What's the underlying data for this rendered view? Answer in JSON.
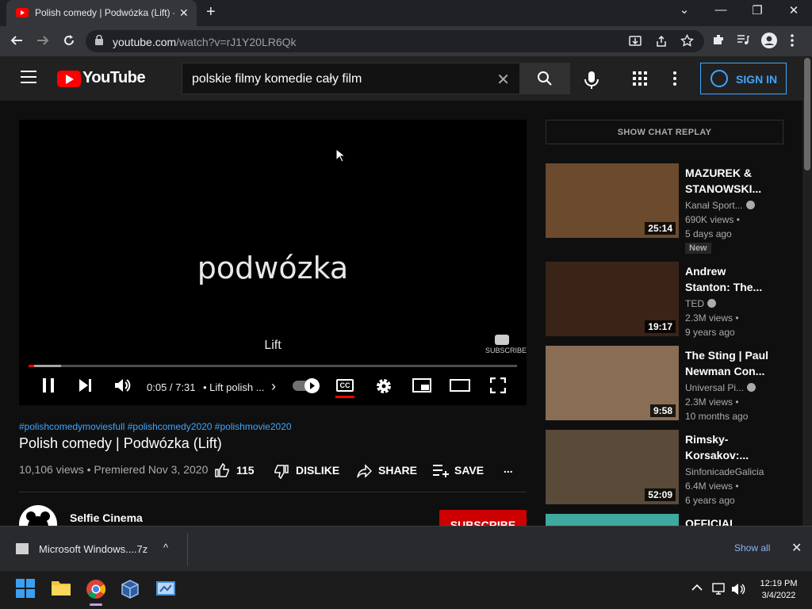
{
  "browser": {
    "tab_title": "Polish comedy | Podwózka (Lift) -",
    "tab_close": "✕",
    "new_tab": "+",
    "url_host": "youtube.com",
    "url_path": "/watch?v=rJ1Y20LR6Qk",
    "window_controls": [
      "⌄",
      "—",
      "❐",
      "✕"
    ]
  },
  "header": {
    "logo": "YouTube",
    "search_value": "polskie filmy komedie cały film",
    "search_clear": "✕",
    "sign_in": "SIGN IN"
  },
  "player": {
    "overlay_title": "podwózka",
    "caption": "Lift",
    "watermark": "SUBSCRIBE",
    "time": "0:05 / 7:31",
    "chapter": "• Lift polish ...",
    "chapter_arrow": "›",
    "cc": "CC",
    "progress_played": 0.011,
    "progress_buffered": 0.066
  },
  "video": {
    "hashtags": "#polishcomedymoviesfull #polishcomedy2020 #polishmovie2020",
    "title": "Polish comedy | Podwózka (Lift)",
    "views": "10,106 views • Premiered Nov 3, 2020",
    "likes": "115",
    "dislike": "DISLIKE",
    "share": "SHARE",
    "save": "SAVE",
    "more": "...",
    "channel": "Selfie Cinema",
    "subscribe": "SUBSCRIBE"
  },
  "sidebar": {
    "chat_replay": "SHOW CHAT REPLAY",
    "recommendations": [
      {
        "title": "MAZUREK & STANOWSKI...",
        "channel": "Kanał Sport...",
        "verified": true,
        "views": "690K views •",
        "age": "5 days ago",
        "badge": "New",
        "duration": "25:14",
        "thumb_color": "#6b4a2e"
      },
      {
        "title": "Andrew Stanton: The...",
        "channel": "TED",
        "verified": true,
        "views": "2.3M views •",
        "age": "9 years ago",
        "badge": "",
        "duration": "19:17",
        "thumb_color": "#3a2418"
      },
      {
        "title": "The Sting | Paul Newman Con...",
        "channel": "Universal Pi...",
        "verified": true,
        "views": "2.3M views •",
        "age": "10 months ago",
        "badge": "",
        "duration": "9:58",
        "thumb_color": "#8a6d55"
      },
      {
        "title": "Rimsky-Korsakov:...",
        "channel": "SinfonicadeGalicia",
        "verified": false,
        "views": "6.4M views •",
        "age": "6 years ago",
        "badge": "",
        "duration": "52:09",
        "thumb_color": "#5a4a3a"
      },
      {
        "title": "OFFICIAL",
        "channel": "",
        "verified": false,
        "views": "",
        "age": "",
        "badge": "",
        "duration": "",
        "thumb_color": "#3fa8a0"
      }
    ]
  },
  "downloads": {
    "file_name": "Microsoft Windows....7z",
    "arrow": "^",
    "show_all": "Show all",
    "close": "✕"
  },
  "taskbar": {
    "time": "12:19 PM",
    "date": "3/4/2022"
  }
}
